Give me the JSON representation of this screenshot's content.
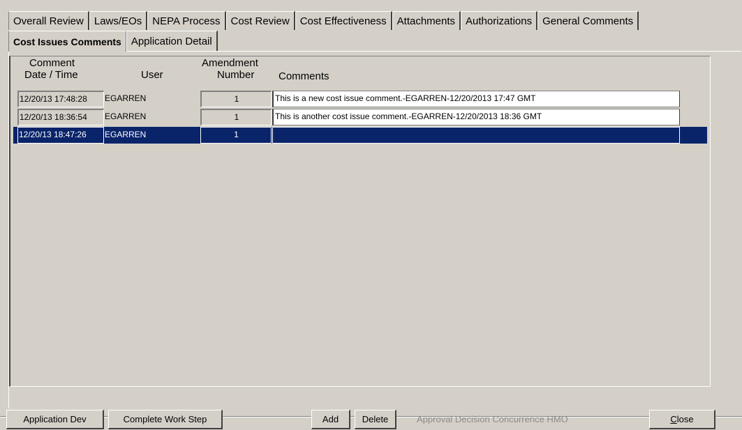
{
  "tabs_row1": [
    "Overall Review",
    "Laws/EOs",
    "NEPA Process",
    "Cost Review",
    "Cost Effectiveness",
    "Attachments",
    "Authorizations",
    "General Comments"
  ],
  "tabs_row2": [
    "Cost Issues Comments",
    "Application Detail"
  ],
  "active_tab": "Cost Issues Comments",
  "grid": {
    "headers": {
      "comment_date_line1": "Comment",
      "comment_date_line2": "Date / Time",
      "user": "User",
      "amendment_line1": "Amendment",
      "amendment_line2": "Number",
      "comments": "Comments"
    },
    "rows": [
      {
        "date": "12/20/13 17:48:28",
        "user": "EGARREN",
        "amendment": "1",
        "comment": "This is a new cost issue comment.-EGARREN-12/20/2013 17:47 GMT"
      },
      {
        "date": "12/20/13 18:36:54",
        "user": "EGARREN",
        "amendment": "1",
        "comment": "This is another cost issue comment.-EGARREN-12/20/2013 18:36 GMT"
      },
      {
        "date": "12/20/13 18:47:26",
        "user": "EGARREN",
        "amendment": "1",
        "comment": ""
      }
    ],
    "selected_row_index": 2
  },
  "toolbar": {
    "application_dev": "Application Dev",
    "complete_work_step": "Complete Work Step",
    "add": "Add",
    "delete": "Delete",
    "status_text": "Approval Decision Concurrence  HMO",
    "close_prefix": "",
    "close_underlined": "C",
    "close_rest": "lose"
  },
  "colors": {
    "background": "#d4d0c8",
    "selection": "#0a246a",
    "disabled_text": "#8e8c87"
  }
}
